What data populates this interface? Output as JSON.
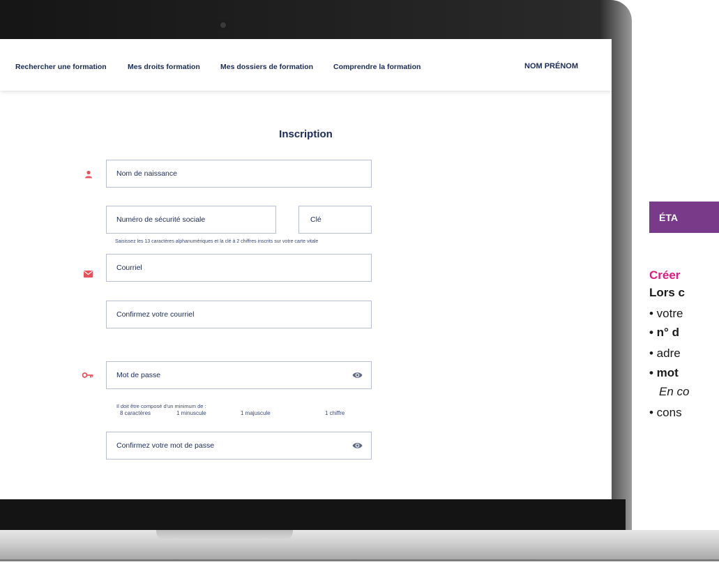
{
  "nav": {
    "items": [
      {
        "label": "Rechercher une formation"
      },
      {
        "label": "Mes droits formation"
      },
      {
        "label": "Mes dossiers de formation"
      },
      {
        "label": "Comprendre la formation"
      }
    ],
    "user": "NOM PRÉNOM"
  },
  "form": {
    "title": "Inscription",
    "birth_name_placeholder": "Nom de naissance",
    "ssn_placeholder": "Numéro de sécurité sociale",
    "key_placeholder": "Clé",
    "ssn_hint": "Saisissez les 13 caractères alphanumériques et la clé à 2 chiffres inscrits sur votre carte vitale",
    "email_placeholder": "Courriel",
    "email_confirm_placeholder": "Confirmez votre courriel",
    "password_placeholder": "Mot de passe",
    "password_rules_intro": "Il doit être composé d'un minimum de :",
    "password_rules": [
      "8 caractères",
      "1 minuscule",
      "1 majuscule",
      "1 chiffre"
    ],
    "password_confirm_placeholder": "Confirmez votre mot de passe"
  },
  "side": {
    "banner": "ÉTA",
    "line1": "Créer",
    "line2": "Lors c",
    "line3": "• votre",
    "line4": "• n° d",
    "line5": "• adre",
    "line6": "• mot",
    "line7": "En co",
    "line8": "• cons"
  },
  "colors": {
    "accent_icon": "#e8525b",
    "navy": "#1a2a55",
    "banner": "#7a3a8a",
    "pink": "#e0197d"
  },
  "icons": {
    "user": "person-icon",
    "email": "envelope-icon",
    "password": "key-icon",
    "reveal": "eye-icon"
  }
}
